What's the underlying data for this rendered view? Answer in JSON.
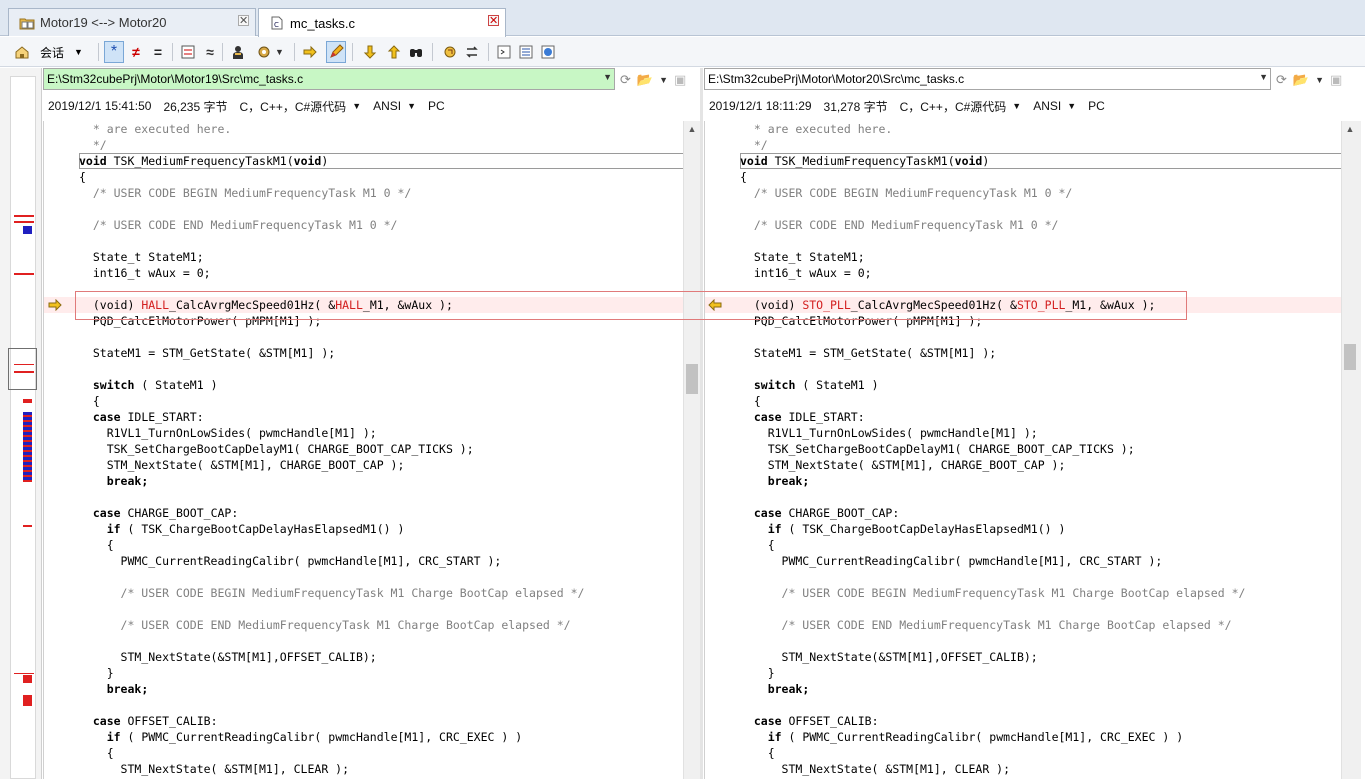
{
  "tabs": [
    {
      "label": "Motor19 <--> Motor20",
      "active": false
    },
    {
      "label": "mc_tasks.c",
      "active": true
    }
  ],
  "toolbar": {
    "session_label": "会话"
  },
  "left": {
    "path": "E:\\Stm32cubePrj\\Motor\\Motor19\\Src\\mc_tasks.c",
    "timestamp": "2019/12/1 15:41:50",
    "size": "26,235 字节",
    "format": "C，C++，C#源代码",
    "encoding": "ANSI",
    "line_ending": "PC"
  },
  "right": {
    "path": "E:\\Stm32cubePrj\\Motor\\Motor20\\Src\\mc_tasks.c",
    "timestamp": "2019/12/1 18:11:29",
    "size": "31,278 字节",
    "format": "C，C++，C#源代码",
    "encoding": "ANSI",
    "line_ending": "PC"
  },
  "left_lines": [
    [
      {
        "t": "  * are executed here.",
        "c": "cm"
      }
    ],
    [
      {
        "t": "  */",
        "c": "cm"
      }
    ],
    [
      {
        "t": "void",
        "c": "kw"
      },
      {
        "t": " TSK_MediumFrequencyTaskM1("
      },
      {
        "t": "void",
        "c": "kw"
      },
      {
        "t": ")"
      }
    ],
    [
      {
        "t": "{"
      }
    ],
    [
      {
        "t": "  /* USER CODE BEGIN MediumFrequencyTask M1 0 */",
        "c": "cm"
      }
    ],
    [],
    [
      {
        "t": "  /* USER CODE END MediumFrequencyTask M1 0 */",
        "c": "cm"
      }
    ],
    [],
    [
      {
        "t": "  State_t StateM1;"
      }
    ],
    [
      {
        "t": "  int16_t wAux = 0;"
      }
    ],
    [],
    [
      {
        "t": "  (void) "
      },
      {
        "t": "HALL",
        "c": "hl"
      },
      {
        "t": "_CalcAvrgMecSpeed01Hz( &"
      },
      {
        "t": "HALL",
        "c": "hl"
      },
      {
        "t": "_M1, &wAux );"
      }
    ],
    [
      {
        "t": "  PQD_CalcElMotorPower( pMPM[M1] );"
      }
    ],
    [],
    [
      {
        "t": "  StateM1 = STM_GetState( &STM[M1] );"
      }
    ],
    [],
    [
      {
        "t": "  "
      },
      {
        "t": "switch",
        "c": "kw"
      },
      {
        "t": " ( StateM1 )"
      }
    ],
    [
      {
        "t": "  {"
      }
    ],
    [
      {
        "t": "  "
      },
      {
        "t": "case",
        "c": "kw"
      },
      {
        "t": " IDLE_START:"
      }
    ],
    [
      {
        "t": "    R1VL1_TurnOnLowSides( pwmcHandle[M1] );"
      }
    ],
    [
      {
        "t": "    TSK_SetChargeBootCapDelayM1( CHARGE_BOOT_CAP_TICKS );"
      }
    ],
    [
      {
        "t": "    STM_NextState( &STM[M1], CHARGE_BOOT_CAP );"
      }
    ],
    [
      {
        "t": "    "
      },
      {
        "t": "break;",
        "c": "kw"
      }
    ],
    [],
    [
      {
        "t": "  "
      },
      {
        "t": "case",
        "c": "kw"
      },
      {
        "t": " CHARGE_BOOT_CAP:"
      }
    ],
    [
      {
        "t": "    "
      },
      {
        "t": "if",
        "c": "kw"
      },
      {
        "t": " ( TSK_ChargeBootCapDelayHasElapsedM1() )"
      }
    ],
    [
      {
        "t": "    {"
      }
    ],
    [
      {
        "t": "      PWMC_CurrentReadingCalibr( pwmcHandle[M1], CRC_START );"
      }
    ],
    [],
    [
      {
        "t": "      /* USER CODE BEGIN MediumFrequencyTask M1 Charge BootCap elapsed */",
        "c": "cm"
      }
    ],
    [],
    [
      {
        "t": "      /* USER CODE END MediumFrequencyTask M1 Charge BootCap elapsed */",
        "c": "cm"
      }
    ],
    [],
    [
      {
        "t": "      STM_NextState(&STM[M1],OFFSET_CALIB);"
      }
    ],
    [
      {
        "t": "    }"
      }
    ],
    [
      {
        "t": "    "
      },
      {
        "t": "break;",
        "c": "kw"
      }
    ],
    [],
    [
      {
        "t": "  "
      },
      {
        "t": "case",
        "c": "kw"
      },
      {
        "t": " OFFSET_CALIB:"
      }
    ],
    [
      {
        "t": "    "
      },
      {
        "t": "if",
        "c": "kw"
      },
      {
        "t": " ( PWMC_CurrentReadingCalibr( pwmcHandle[M1], CRC_EXEC ) )"
      }
    ],
    [
      {
        "t": "    {"
      }
    ],
    [
      {
        "t": "      STM_NextState( &STM[M1], CLEAR );"
      }
    ]
  ],
  "right_lines": [
    [
      {
        "t": "  * are executed here.",
        "c": "cm"
      }
    ],
    [
      {
        "t": "  */",
        "c": "cm"
      }
    ],
    [
      {
        "t": "void",
        "c": "kw"
      },
      {
        "t": " TSK_MediumFrequencyTaskM1("
      },
      {
        "t": "void",
        "c": "kw"
      },
      {
        "t": ")"
      }
    ],
    [
      {
        "t": "{"
      }
    ],
    [
      {
        "t": "  /* USER CODE BEGIN MediumFrequencyTask M1 0 */",
        "c": "cm"
      }
    ],
    [],
    [
      {
        "t": "  /* USER CODE END MediumFrequencyTask M1 0 */",
        "c": "cm"
      }
    ],
    [],
    [
      {
        "t": "  State_t StateM1;"
      }
    ],
    [
      {
        "t": "  int16_t wAux = 0;"
      }
    ],
    [],
    [
      {
        "t": "  (void) "
      },
      {
        "t": "STO_PLL",
        "c": "hl"
      },
      {
        "t": "_CalcAvrgMecSpeed01Hz( &"
      },
      {
        "t": "STO_PLL",
        "c": "hl"
      },
      {
        "t": "_M1, &wAux );"
      }
    ],
    [
      {
        "t": "  PQD_CalcElMotorPower( pMPM[M1] );"
      }
    ],
    [],
    [
      {
        "t": "  StateM1 = STM_GetState( &STM[M1] );"
      }
    ],
    [],
    [
      {
        "t": "  "
      },
      {
        "t": "switch",
        "c": "kw"
      },
      {
        "t": " ( StateM1 )"
      }
    ],
    [
      {
        "t": "  {"
      }
    ],
    [
      {
        "t": "  "
      },
      {
        "t": "case",
        "c": "kw"
      },
      {
        "t": " IDLE_START:"
      }
    ],
    [
      {
        "t": "    R1VL1_TurnOnLowSides( pwmcHandle[M1] );"
      }
    ],
    [
      {
        "t": "    TSK_SetChargeBootCapDelayM1( CHARGE_BOOT_CAP_TICKS );"
      }
    ],
    [
      {
        "t": "    STM_NextState( &STM[M1], CHARGE_BOOT_CAP );"
      }
    ],
    [
      {
        "t": "    "
      },
      {
        "t": "break;",
        "c": "kw"
      }
    ],
    [],
    [
      {
        "t": "  "
      },
      {
        "t": "case",
        "c": "kw"
      },
      {
        "t": " CHARGE_BOOT_CAP:"
      }
    ],
    [
      {
        "t": "    "
      },
      {
        "t": "if",
        "c": "kw"
      },
      {
        "t": " ( TSK_ChargeBootCapDelayHasElapsedM1() )"
      }
    ],
    [
      {
        "t": "    {"
      }
    ],
    [
      {
        "t": "      PWMC_CurrentReadingCalibr( pwmcHandle[M1], CRC_START );"
      }
    ],
    [],
    [
      {
        "t": "      /* USER CODE BEGIN MediumFrequencyTask M1 Charge BootCap elapsed */",
        "c": "cm"
      }
    ],
    [],
    [
      {
        "t": "      /* USER CODE END MediumFrequencyTask M1 Charge BootCap elapsed */",
        "c": "cm"
      }
    ],
    [],
    [
      {
        "t": "      STM_NextState(&STM[M1],OFFSET_CALIB);"
      }
    ],
    [
      {
        "t": "    }"
      }
    ],
    [
      {
        "t": "    "
      },
      {
        "t": "break;",
        "c": "kw"
      }
    ],
    [],
    [
      {
        "t": "  "
      },
      {
        "t": "case",
        "c": "kw"
      },
      {
        "t": " OFFSET_CALIB:"
      }
    ],
    [
      {
        "t": "    "
      },
      {
        "t": "if",
        "c": "kw"
      },
      {
        "t": " ( PWMC_CurrentReadingCalibr( pwmcHandle[M1], CRC_EXEC ) )"
      }
    ],
    [
      {
        "t": "    {"
      }
    ],
    [
      {
        "t": "      STM_NextState( &STM[M1], CLEAR );"
      }
    ]
  ],
  "current_diff_line": 11,
  "colors": {
    "diff_text": "#d32020",
    "diff_box": "#e07a7a",
    "overview_changed": "#e02020",
    "overview_moved": "#2020c0",
    "path_bg_left": "#c8f7c5"
  },
  "icons": [
    "folder-compare-icon",
    "c-file-icon",
    "close-icon",
    "home-icon",
    "star-filter-icon",
    "not-equal-icon",
    "equal-icon",
    "expand-icon",
    "approx-icon",
    "person-icon",
    "settings-icon",
    "next-diff-icon",
    "edit-icon",
    "down-arrow-icon",
    "up-arrow-icon",
    "binoculars-icon",
    "swap-icon",
    "open-folder-icon",
    "save-icon",
    "refresh-icon"
  ]
}
